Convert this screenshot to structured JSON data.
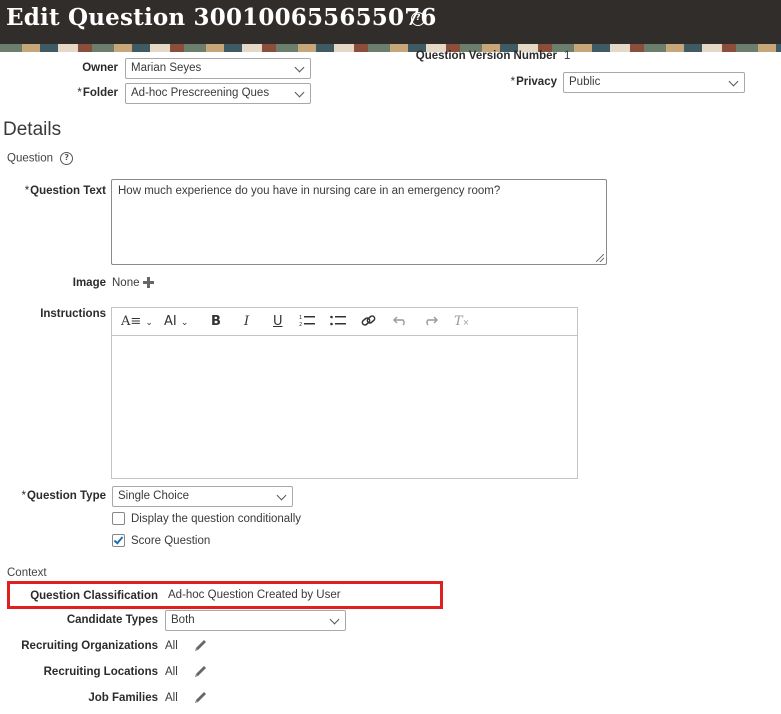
{
  "header": {
    "title": "Edit Question 300100655655076"
  },
  "top_fields": {
    "owner": {
      "label": "Owner",
      "value": "Marian Seyes"
    },
    "folder": {
      "label": "Folder",
      "value": "Ad-hoc Prescreening Ques"
    },
    "version": {
      "label": "Question Version Number",
      "value": "1"
    },
    "privacy": {
      "label": "Privacy",
      "value": "Public"
    }
  },
  "details": {
    "section_title": "Details",
    "subsection_title": "Question",
    "question_text": {
      "label": "Question Text",
      "value": "How much experience do you have in nursing care in an emergency room?"
    },
    "image": {
      "label": "Image",
      "value": "None"
    },
    "instructions": {
      "label": "Instructions",
      "toolbar": {
        "font_size": "A≡",
        "font_family": "AI",
        "bold": "B",
        "italic": "I",
        "underline": "U",
        "clear_format": "T"
      }
    },
    "question_type": {
      "label": "Question Type",
      "value": "Single Choice"
    },
    "display_conditionally": {
      "label": "Display the question conditionally",
      "checked": false
    },
    "score_question": {
      "label": "Score Question",
      "checked": true
    }
  },
  "context": {
    "section_title": "Context",
    "classification": {
      "label": "Question Classification",
      "value": "Ad-hoc Question Created by User"
    },
    "candidate_types": {
      "label": "Candidate Types",
      "value": "Both"
    },
    "recruiting_organizations": {
      "label": "Recruiting Organizations",
      "value": "All"
    },
    "recruiting_locations": {
      "label": "Recruiting Locations",
      "value": "All"
    },
    "job_families": {
      "label": "Job Families",
      "value": "All"
    }
  },
  "colors": {
    "header_bg": "#312d2a",
    "highlight": "#e0201e",
    "accent": "#1f6fb2"
  },
  "icons": [
    "help-icon",
    "chevron-down-icon",
    "plus-icon",
    "bold-icon",
    "italic-icon",
    "underline-icon",
    "numbered-list-icon",
    "bulleted-list-icon",
    "link-icon",
    "undo-icon",
    "redo-icon",
    "clear-format-icon",
    "checkmark-icon",
    "pencil-icon"
  ]
}
